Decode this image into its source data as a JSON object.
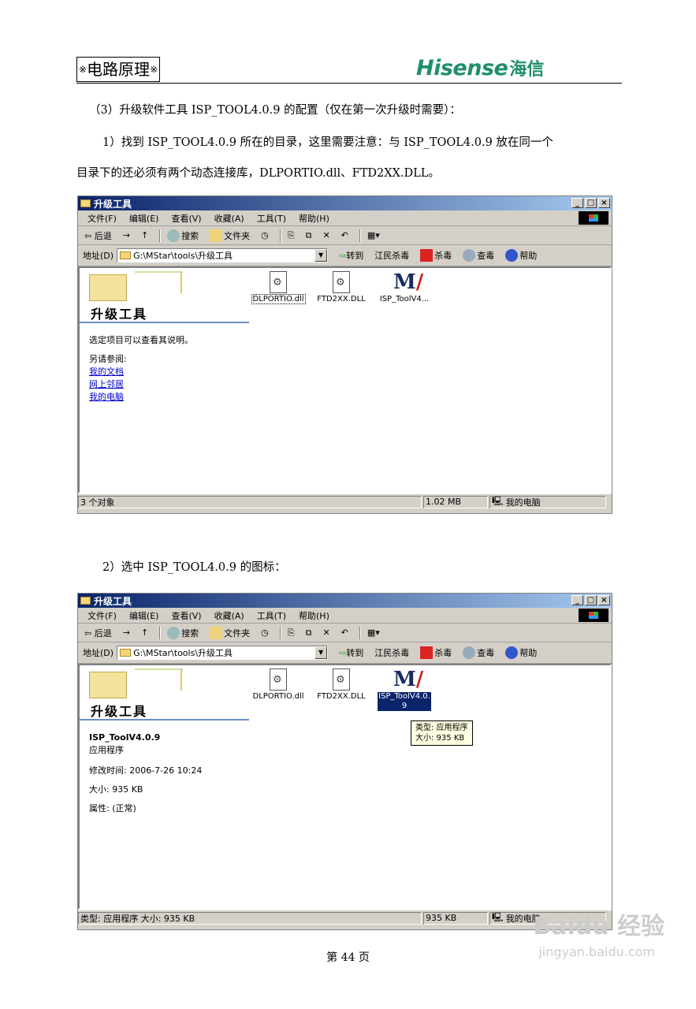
{
  "header": {
    "left_text": "电路原理",
    "mark": "※",
    "logo_en": "Hisense",
    "logo_zh": "海信"
  },
  "paragraphs": {
    "p1": "（3）升级软件工具 ISP_TOOL4.0.9 的配置（仅在第一次升级时需要）：",
    "p2a": "1）找到 ISP_TOOL4.0.9 所在的目录，这里需要注意：与 ISP_TOOL4.0.9 放在同一个",
    "p2b": "目录下的还必须有两个动态连接库，DLPORTIO.dll、FTD2XX.DLL。",
    "p3": "2）选中 ISP_TOOL4.0.9 的图标："
  },
  "window": {
    "title": "升级工具",
    "buttons": [
      "_",
      "□",
      "×"
    ],
    "menu": [
      "文件(F)",
      "编辑(E)",
      "查看(V)",
      "收藏(A)",
      "工具(T)",
      "帮助(H)"
    ],
    "toolbar": {
      "back": "⇦ 后退",
      "forward": "→",
      "up": "↑",
      "search": "搜索",
      "folders": "文件夹"
    },
    "address_label": "地址(D)",
    "address_value": "G:\\MStar\\tools\\升级工具",
    "go": "转到",
    "links": [
      "江民杀毒",
      "杀毒",
      "查毒",
      "帮助"
    ],
    "panel_title": "升级工具",
    "files": [
      "DLPORTIO.dll",
      "FTD2XX.DLL",
      "ISP_ToolV4...",
      "ISP_ToolV4.0.9"
    ],
    "file_sel_line1": "ISP_ToolV4.0.",
    "file_sel_line2": "9"
  },
  "window1": {
    "hint": "选定项目可以查看其说明。",
    "see_also": "另请参阅:",
    "see_links": [
      "我的文档",
      "网上邻居",
      "我的电脑"
    ],
    "status_count": "3 个对象",
    "status_size": "1.02 MB",
    "status_loc": "我的电脑"
  },
  "window2": {
    "name": "ISP_ToolV4.0.9",
    "type": "应用程序",
    "modified": "修改时间: 2006-7-26 10:24",
    "size": "大小: 935 KB",
    "attrs": "属性: (正常)",
    "tooltip1": "类型: 应用程序",
    "tooltip2": "大小: 935 KB",
    "status_info": "类型: 应用程序 大小: 935 KB",
    "status_size": "935 KB",
    "status_loc": "我的电脑"
  },
  "footer": "第 44 页",
  "watermark": {
    "brand": "Baidu 经验",
    "url": "jingyan.baidu.com"
  }
}
